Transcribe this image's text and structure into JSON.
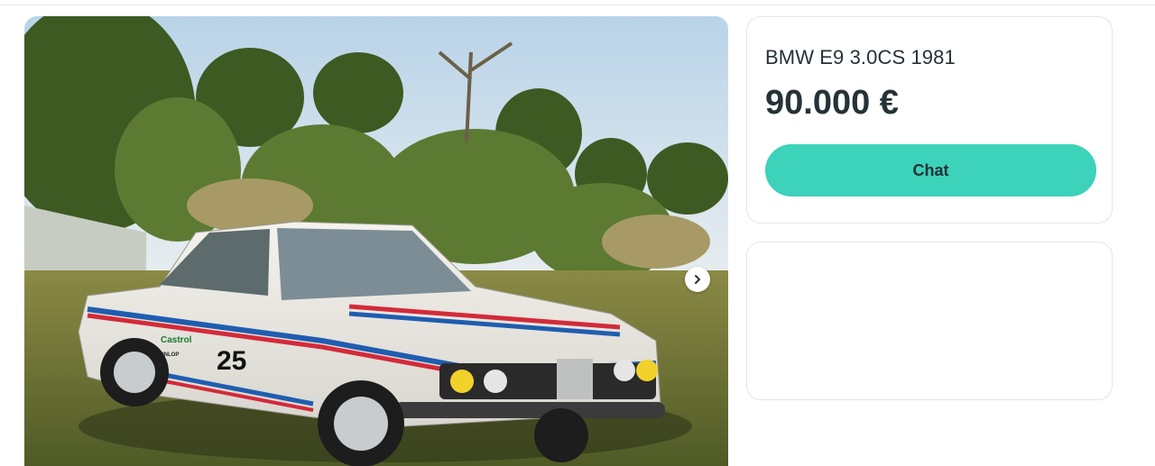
{
  "listing": {
    "title": "BMW E9 3.0CS 1981",
    "price": "90.000 €",
    "chat_label": "Chat"
  },
  "car_decal": {
    "number": "25",
    "sponsor": "Castrol",
    "sponsor_secondary": "DUNLOP"
  },
  "colors": {
    "accent": "#3dd2ba",
    "text": "#253238",
    "border": "#e2e6e9"
  },
  "icons": {
    "gallery_next": "chevron-right-icon"
  }
}
